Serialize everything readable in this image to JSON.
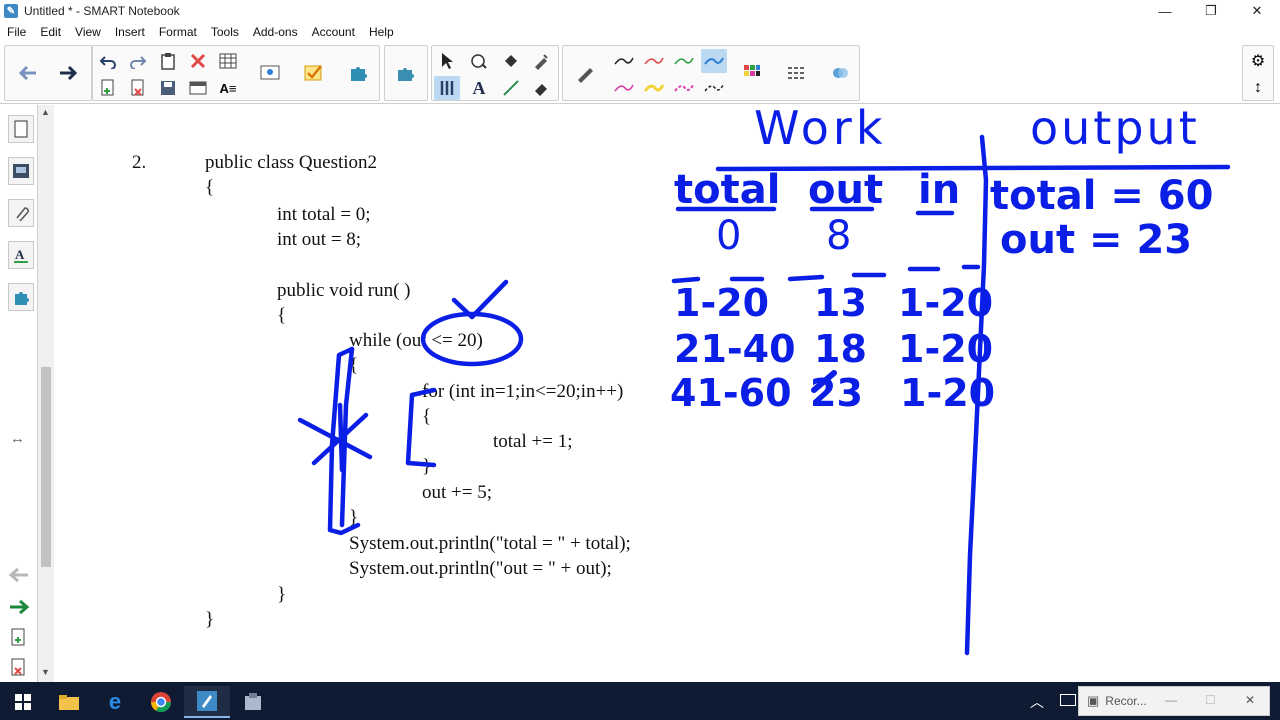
{
  "window": {
    "title": "Untitled * - SMART Notebook",
    "minimize_label": "—",
    "restore_label": "❐",
    "close_label": "✕"
  },
  "menu": {
    "items": [
      "File",
      "Edit",
      "View",
      "Insert",
      "Format",
      "Tools",
      "Add-ons",
      "Account",
      "Help"
    ]
  },
  "toolbar": {
    "back_icon": "arrow-left-icon",
    "forward_icon": "arrow-right-icon",
    "undo_icon": "undo-icon",
    "redo_icon": "redo-icon",
    "delete_icon": "delete-icon",
    "table_icon": "table-icon",
    "select_icon": "select-pointer-icon",
    "pen_color_selected": "#2d7fd6"
  },
  "code": {
    "number": "2.",
    "lines": [
      "public class Question2",
      "{",
      "int total = 0;",
      "int out = 8;",
      "public void run( )",
      "{",
      "while (out <= 20)",
      "{",
      "for (int in=1;in<=20;in++)",
      "{",
      "total += 1;",
      "}",
      "out += 5;",
      "}",
      "System.out.println(\"total = \" + total);",
      "System.out.println(\"out = \" + out);",
      "}",
      "}"
    ]
  },
  "handwriting": {
    "ink_color": "#0a1ee6",
    "work_heading": "Work",
    "output_heading": "output",
    "col_total": "total",
    "col_out": "out",
    "col_in": "in",
    "init_total": "0",
    "init_out": "8",
    "rows": [
      {
        "total": "1-20",
        "out": "13",
        "in": "1-20"
      },
      {
        "total": "21-40",
        "out": "18",
        "in": "1-20"
      },
      {
        "total": "41-60",
        "out": "23",
        "in": "1-20"
      }
    ],
    "output_total": "total = 60",
    "output_out": "out = 23"
  },
  "taskbar": {
    "recorder_label": "Recor..."
  }
}
